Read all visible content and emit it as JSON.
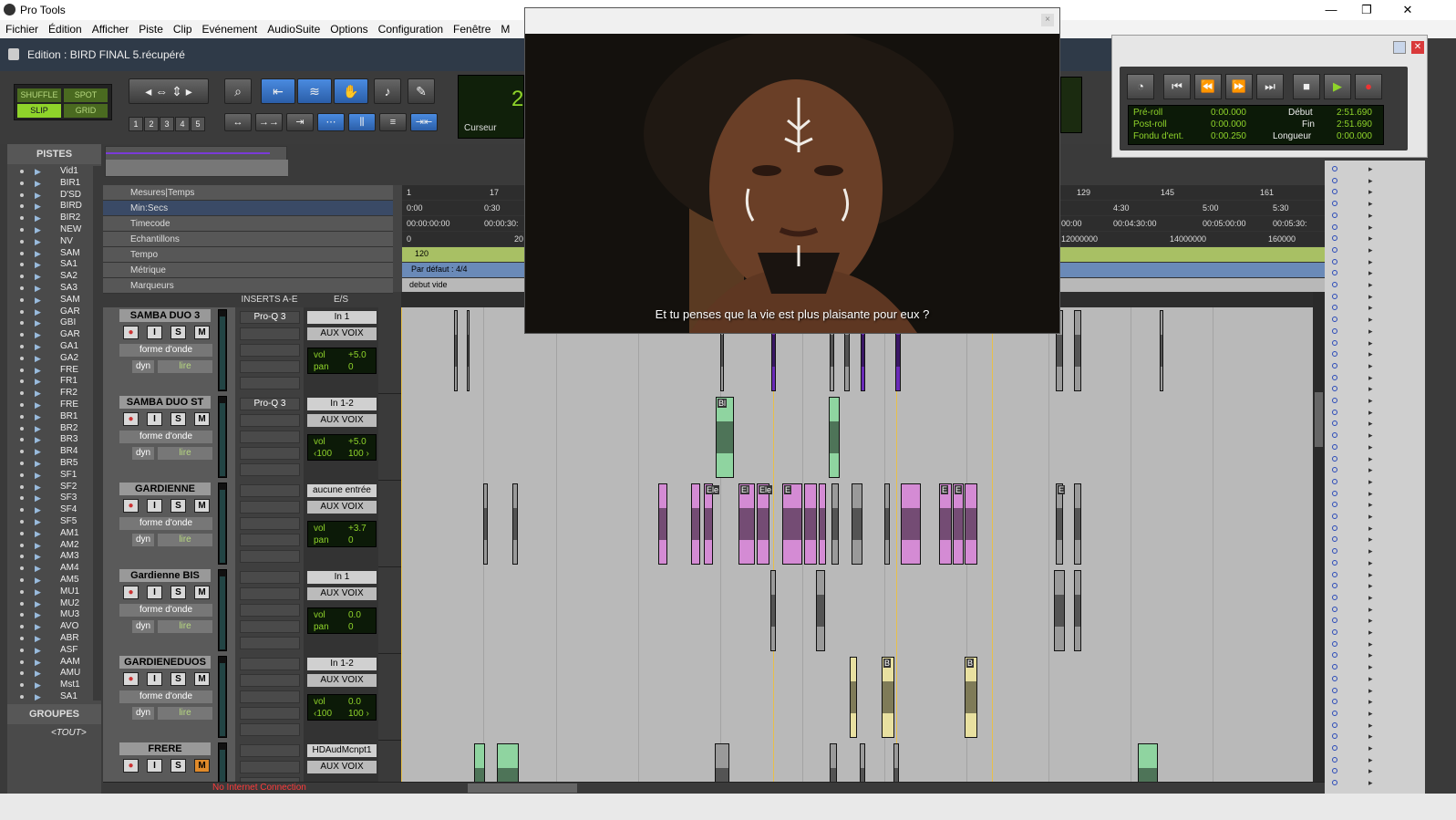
{
  "app": {
    "title": "Pro Tools",
    "win_minimize": "—",
    "win_maximize": "❐",
    "win_close": "✕"
  },
  "menu": [
    "Fichier",
    "Édition",
    "Afficher",
    "Piste",
    "Clip",
    "Evénement",
    "AudioSuite",
    "Options",
    "Configuration",
    "Fenêtre",
    "M"
  ],
  "edit_window": {
    "title": "Edition : BIRD FINAL 5.récupéré"
  },
  "toolbar": {
    "modes": {
      "shuffle": "SHUFFLE",
      "spot": "SPOT",
      "slip": "SLIP",
      "grid": "GRID"
    },
    "zoom_presets": [
      "1",
      "2",
      "3",
      "4",
      "5"
    ],
    "counter_value": "2",
    "counter_label": "Curseur"
  },
  "video": {
    "subtitle": "Et tu penses que la vie est plus plaisante pour eux ?",
    "close": "×"
  },
  "transport": {
    "preroll_label": "Pré-roll",
    "preroll": "0:00.000",
    "postroll_label": "Post-roll",
    "postroll": "0:00.000",
    "fade_label": "Fondu d'ent.",
    "fade": "0:00.250",
    "start_label": "Début",
    "start": "2:51.690",
    "end_label": "Fin",
    "end": "2:51.690",
    "length_label": "Longueur",
    "length": "0:00.000"
  },
  "tracks_panel": {
    "title": "PISTES",
    "items": [
      "Vid1",
      "BIR1",
      "D'SD",
      "BIRD",
      "BIR2",
      "NEW",
      "NV",
      "SAM",
      "SA1",
      "SA2",
      "SA3",
      "SAM",
      "GAR",
      "GBI",
      "GAR",
      "GA1",
      "GA2",
      "FRE",
      "FR1",
      "FR2",
      "FRE",
      "BR1",
      "BR2",
      "BR3",
      "BR4",
      "BR5",
      "SF1",
      "SF2",
      "SF3",
      "SF4",
      "SF5",
      "AM1",
      "AM2",
      "AM3",
      "AM4",
      "AM5",
      "MU1",
      "MU2",
      "MU3",
      "AVO",
      "ABR",
      "ASF",
      "AAM",
      "AMU",
      "Mst1",
      "SA1"
    ]
  },
  "groups_panel": {
    "title": "GROUPES",
    "item": "<TOUT>"
  },
  "rulers": {
    "rows": [
      "Mesures|Temps",
      "Min:Secs",
      "Timecode",
      "Echantillons",
      "Tempo",
      "Métrique",
      "Marqueurs"
    ],
    "bars": [
      "1",
      "17",
      "129",
      "145",
      "161"
    ],
    "minsecs": [
      "0:00",
      "0:30",
      "4:30",
      "5:00",
      "5:30"
    ],
    "timecode": [
      "00:00:00:00",
      "00:00:30:",
      "00:00",
      "00:04:30:00",
      "00:05:00:00",
      "00:05:30:"
    ],
    "samples": [
      "0",
      "20",
      "12000000",
      "14000000",
      "160000"
    ],
    "tempo_value": "120",
    "meter_value": "Par défaut : 4/4",
    "marker_value": "debut vide"
  },
  "mix_headers": {
    "inserts": "INSERTS A-E",
    "io": "E/S"
  },
  "tracks": [
    {
      "name": "SAMBA DUO 3",
      "insert": "Pro-Q 3",
      "input": "In 1",
      "output": "AUX VOIX",
      "vol": "+5.0",
      "pan_label": "pan",
      "pan": "0",
      "pan_r": "",
      "view": "forme d'onde",
      "mode": "lire",
      "muted": false
    },
    {
      "name": "SAMBA DUO ST",
      "insert": "Pro-Q 3",
      "input": "In 1-2",
      "output": "AUX VOIX",
      "vol": "+5.0",
      "pan_label": "‹100",
      "pan": "100 ›",
      "pan_r": "",
      "view": "forme d'onde",
      "mode": "lire",
      "muted": false
    },
    {
      "name": "GARDIENNE",
      "insert": "",
      "input": "aucune entrée",
      "output": "AUX VOIX",
      "vol": "+3.7",
      "pan_label": "pan",
      "pan": "0",
      "pan_r": "",
      "view": "forme d'onde",
      "mode": "lire",
      "muted": false
    },
    {
      "name": "Gardienne BIS",
      "insert": "",
      "input": "In 1",
      "output": "AUX VOIX",
      "vol": "0.0",
      "pan_label": "pan",
      "pan": "0",
      "pan_r": "",
      "view": "forme d'onde",
      "mode": "lire",
      "muted": false
    },
    {
      "name": "GARDIENEDUOS",
      "insert": "",
      "input": "In 1-2",
      "output": "AUX VOIX",
      "vol": "0.0",
      "pan_label": "‹100",
      "pan": "100 ›",
      "pan_r": "",
      "view": "forme d'onde",
      "mode": "lire",
      "muted": false
    },
    {
      "name": "FRERE",
      "insert": "",
      "input": "HDAudMcnpt1",
      "output": "AUX VOIX",
      "vol": "",
      "pan_label": "",
      "pan": "",
      "pan_r": "",
      "view": "",
      "mode": "",
      "muted": true
    }
  ],
  "track_buttons": {
    "rec": "●",
    "input": "I",
    "solo": "S",
    "mute": "M",
    "vol_label": "vol",
    "dyn": "dyn"
  },
  "clips": {
    "track2_label": "Bl",
    "track3_labels": [
      "Ele",
      "El",
      "Ele",
      "E",
      "E",
      "E",
      "E"
    ],
    "track5_labels": [
      "B",
      "B"
    ]
  },
  "status": {
    "message": "No Internet Connection"
  },
  "colors": {
    "accent_green": "#8fd42a",
    "clip_purple": "#6a2ab8",
    "clip_green": "#8fd4a0",
    "clip_pink": "#d48bd4",
    "clip_yellow": "#e8e0a0",
    "selection": "#2b5ea8"
  }
}
